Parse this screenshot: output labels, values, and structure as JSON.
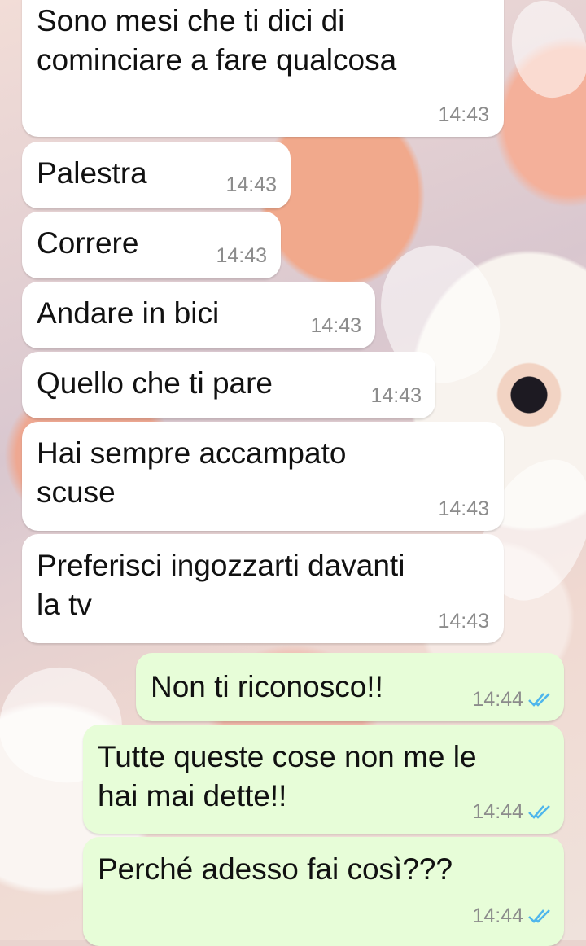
{
  "conversation": {
    "messages": [
      {
        "direction": "incoming",
        "text": "Sono mesi che ti dici di\ncominciare a fare qualcosa",
        "time": "14:43"
      },
      {
        "direction": "incoming",
        "text": "Palestra",
        "time": "14:43"
      },
      {
        "direction": "incoming",
        "text": "Correre",
        "time": "14:43"
      },
      {
        "direction": "incoming",
        "text": "Andare in bici",
        "time": "14:43"
      },
      {
        "direction": "incoming",
        "text": "Quello che ti pare",
        "time": "14:43"
      },
      {
        "direction": "incoming",
        "text": "Hai sempre accampato\nscuse",
        "time": "14:43"
      },
      {
        "direction": "incoming",
        "text": "Preferisci ingozzarti davanti\nla tv",
        "time": "14:43"
      },
      {
        "direction": "outgoing",
        "text": "Non ti riconosco!!",
        "time": "14:44",
        "status": "read"
      },
      {
        "direction": "outgoing",
        "text": "Tutte queste cose non me le\nhai mai dette!!",
        "time": "14:44",
        "status": "read"
      },
      {
        "direction": "outgoing",
        "text": "Perché adesso fai così???",
        "time": "14:44",
        "status": "read"
      }
    ]
  },
  "colors": {
    "incoming_bubble": "#ffffff",
    "outgoing_bubble": "#e7fdd8",
    "read_check": "#4fb6ec",
    "timestamp": "#8c8c8c"
  },
  "icons": {
    "read_receipt": "double-check-icon"
  }
}
